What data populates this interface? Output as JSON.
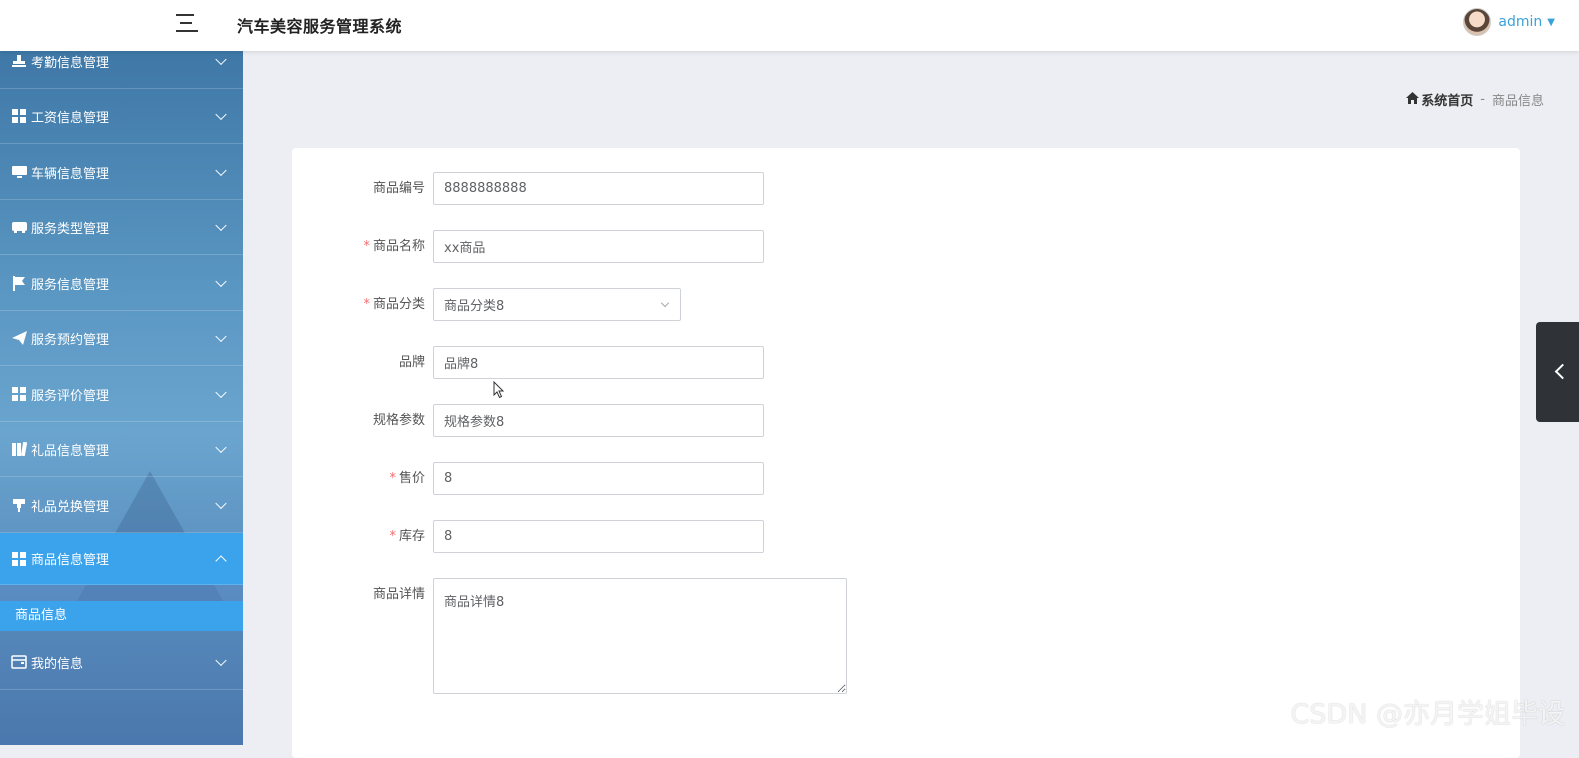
{
  "header": {
    "app_title": "汽车美容服务管理系统",
    "username": "admin"
  },
  "sidebar": {
    "items": [
      {
        "label": "考勤信息管理",
        "icon": "stamp-icon"
      },
      {
        "label": "工资信息管理",
        "icon": "grid-icon"
      },
      {
        "label": "车辆信息管理",
        "icon": "monitor-icon"
      },
      {
        "label": "服务类型管理",
        "icon": "inbox-icon"
      },
      {
        "label": "服务信息管理",
        "icon": "flag-icon"
      },
      {
        "label": "服务预约管理",
        "icon": "send-icon"
      },
      {
        "label": "服务评价管理",
        "icon": "grid-icon"
      },
      {
        "label": "礼品信息管理",
        "icon": "book-icon"
      },
      {
        "label": "礼品兑换管理",
        "icon": "stamp-icon"
      },
      {
        "label": "商品信息管理",
        "icon": "grid-icon"
      },
      {
        "label": "我的信息",
        "icon": "wallet-icon"
      }
    ],
    "active_submenu": "商品信息"
  },
  "breadcrumb": {
    "home": "系统首页",
    "separator": "-",
    "current": "商品信息"
  },
  "form": {
    "product_no": {
      "label": "商品编号",
      "value": "8888888888",
      "required": false
    },
    "product_name": {
      "label": "商品名称",
      "value": "xx商品",
      "required": true
    },
    "category": {
      "label": "商品分类",
      "value": "商品分类8",
      "required": true
    },
    "brand": {
      "label": "品牌",
      "value": "品牌8",
      "required": false
    },
    "spec": {
      "label": "规格参数",
      "value": "规格参数8",
      "required": false
    },
    "price": {
      "label": "售价",
      "value": "8",
      "required": true
    },
    "stock": {
      "label": "库存",
      "value": "8",
      "required": true
    },
    "detail": {
      "label": "商品详情",
      "value": "商品详情8",
      "required": false
    }
  },
  "required_mark": "*",
  "watermark": "CSDN @亦月学姐毕设",
  "colors": {
    "accent": "#3aa3ec",
    "link": "#3aa2d9",
    "required": "#f56c6c"
  }
}
